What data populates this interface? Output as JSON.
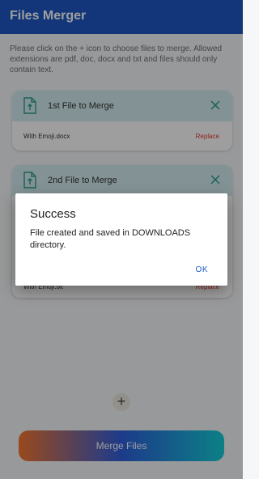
{
  "app": {
    "title": "Files Merger"
  },
  "instructions": "Please click on the + icon to choose files to merge. Allowed extensions are pdf, doc, docx and txt and files should only contain text.",
  "files": [
    {
      "title": "1st File to Merge",
      "file_name": "With Emoji.docx",
      "replace_label": "Replace"
    },
    {
      "title": "2nd File to Merge",
      "file_name": "With Emoji.txt",
      "replace_label": "Replace"
    }
  ],
  "add_button": "+",
  "merge_button": "Merge Files",
  "dialog": {
    "title": "Success",
    "message": "File created and saved in DOWNLOADS directory.",
    "ok_label": "OK"
  },
  "colors": {
    "appbar": "#1d58c4",
    "card_header": "#d3eef0",
    "replace": "#e53935",
    "accent": "#1d58c4"
  },
  "icons": [
    "file-upload-icon",
    "close-icon",
    "add-icon"
  ]
}
